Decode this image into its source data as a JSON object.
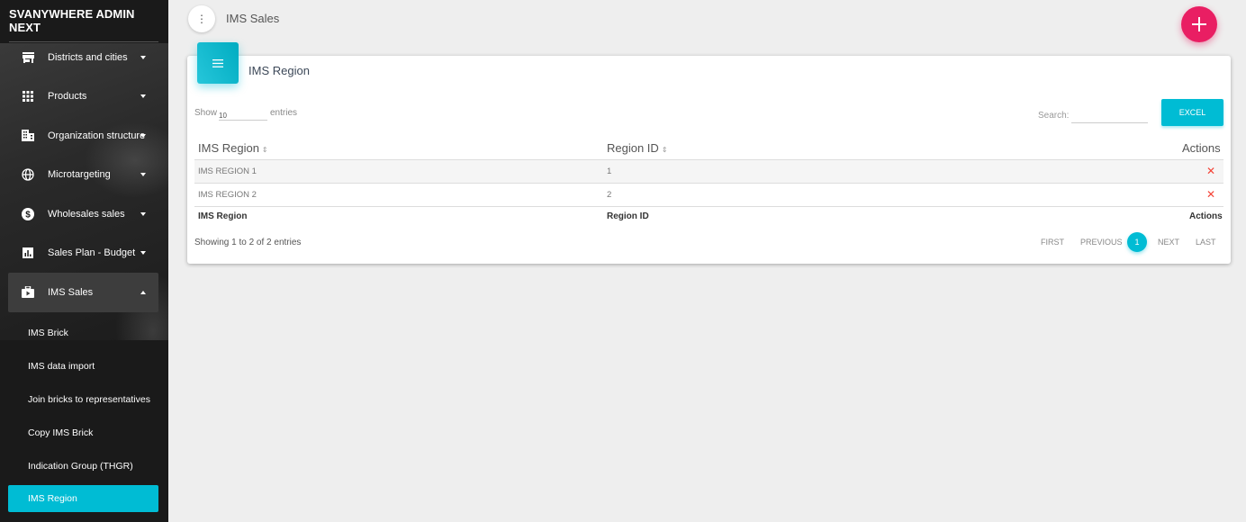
{
  "app": {
    "title": "SVANYWHERE ADMIN NEXT"
  },
  "sidebar": {
    "items": [
      {
        "label": "Districts and cities",
        "icon": "store-icon"
      },
      {
        "label": "Products",
        "icon": "grid-icon"
      },
      {
        "label": "Organization structure",
        "icon": "building-icon"
      },
      {
        "label": "Microtargeting",
        "icon": "globe-icon"
      },
      {
        "label": "Wholesales sales",
        "icon": "dollar-icon"
      },
      {
        "label": "Sales Plan - Budget",
        "icon": "chart-icon"
      },
      {
        "label": "IMS Sales",
        "icon": "briefcase-icon"
      }
    ],
    "subitems": [
      {
        "label": "IMS Brick"
      },
      {
        "label": "IMS data import"
      },
      {
        "label": "Join bricks to representatives"
      },
      {
        "label": "Copy IMS Brick"
      },
      {
        "label": "Indication Group (THGR)"
      },
      {
        "label": "IMS Region"
      }
    ]
  },
  "header": {
    "title": "IMS Sales",
    "menu_glyph": "⋮",
    "fab_glyph": "+"
  },
  "card": {
    "title": "IMS Region",
    "show_label": "Show",
    "page_size": "10",
    "entries_label": "entries",
    "search_label": "Search:",
    "search_value": "",
    "excel_label": "EXCEL"
  },
  "table": {
    "columns": [
      "IMS Region",
      "Region ID",
      "Actions"
    ],
    "sort_glyph": "⇕",
    "rows": [
      {
        "region": "IMS REGION 1",
        "id": "1"
      },
      {
        "region": "IMS REGION 2",
        "id": "2"
      }
    ],
    "delete_glyph": "✕",
    "footer": [
      "IMS Region",
      "Region ID",
      "Actions"
    ]
  },
  "pagination": {
    "info": "Showing 1 to 2 of 2 entries",
    "first": "FIRST",
    "previous": "PREVIOUS",
    "current": "1",
    "next": "NEXT",
    "last": "LAST"
  },
  "colors": {
    "accent": "#00bcd4",
    "fab": "#e91e63",
    "delete": "#f44336",
    "sidebar": "#1a1a1a"
  }
}
